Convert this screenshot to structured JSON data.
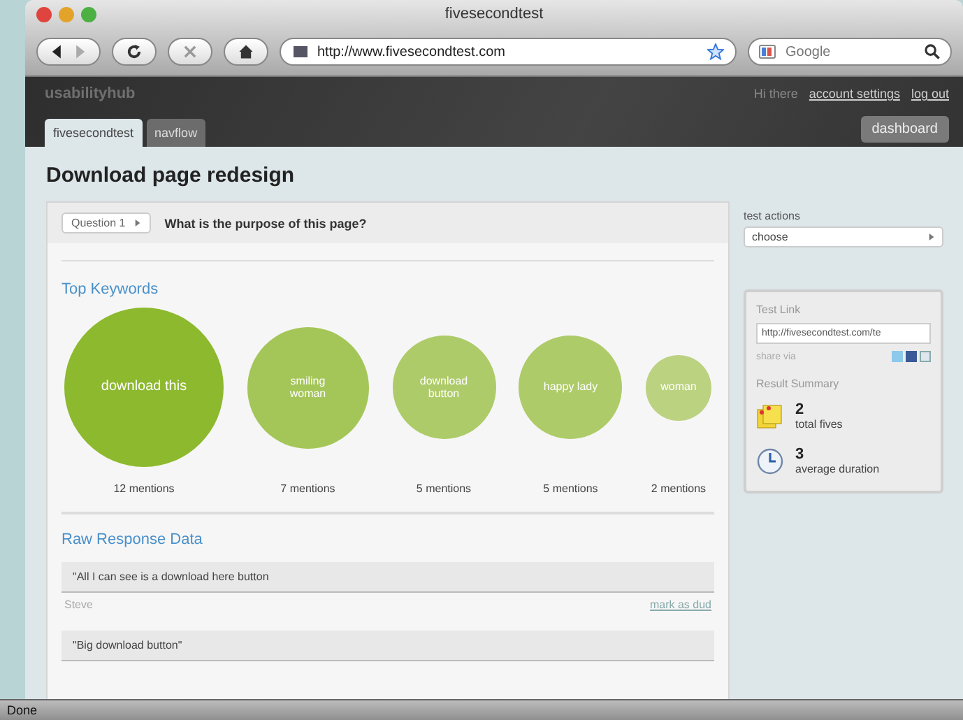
{
  "window": {
    "title": "fivesecondtest"
  },
  "toolbar": {
    "url": "http://www.fivesecondtest.com",
    "search_placeholder": "Google"
  },
  "app_header": {
    "logo": "usabilityhub",
    "greeting": "Hi there",
    "links": [
      "account settings",
      "log out"
    ],
    "tabs": [
      {
        "label": "fivesecondtest",
        "selected": true
      },
      {
        "label": "navflow",
        "selected": false
      }
    ],
    "dashboard_button": "dashboard"
  },
  "page_title": "Download page redesign",
  "question": {
    "select": "Question 1",
    "text": "What is the purpose of this page?"
  },
  "keywords": {
    "heading": "Top Keywords",
    "items": [
      {
        "word": "download this",
        "mentions": "12 mentions"
      },
      {
        "word": "smiling woman",
        "mentions": "7 mentions"
      },
      {
        "word": "download button",
        "mentions": "5 mentions"
      },
      {
        "word": "happy lady",
        "mentions": "5 mentions"
      },
      {
        "word": "woman",
        "mentions": "2 mentions"
      }
    ]
  },
  "responses": {
    "heading": "Raw Response Data",
    "items": [
      {
        "text": "\"All I can see is a download here button",
        "author": "Steve",
        "action": "mark as dud"
      },
      {
        "text": "\"Big download button\""
      }
    ]
  },
  "sidebar": {
    "actions_label": "test actions",
    "actions_select": "choose",
    "test_link": {
      "heading": "Test Link",
      "url": "http://fivesecondtest.com/te",
      "share": "share via"
    },
    "summary": {
      "heading": "Result Summary",
      "stats": [
        {
          "kind": "fives",
          "value": "2",
          "label": "total fives"
        },
        {
          "kind": "duration",
          "value": "3",
          "label": "average duration"
        }
      ]
    }
  },
  "status_bar": "Done"
}
